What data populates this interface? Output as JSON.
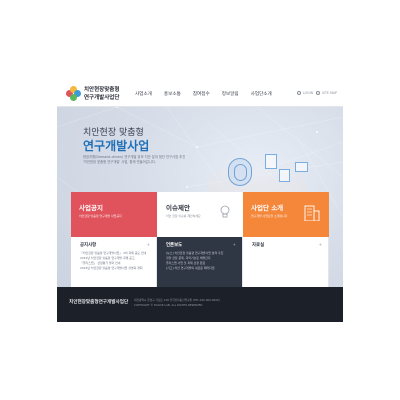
{
  "header": {
    "logo_line1": "치안현장맞춤형",
    "logo_line2": "연구개발사업단",
    "nav": [
      "사업소개",
      "홍보소통",
      "참여접수",
      "정보알림",
      "사업단소개"
    ],
    "links": [
      "LOGIN",
      "SITE MAP"
    ]
  },
  "hero": {
    "subtitle": "치안현장 맞춤형",
    "title": "연구개발사업",
    "desc_line1": "현장지향(Demand-driven) 연구개발 공모 치안 분야 첨단 연구사업 추진",
    "desc_line2": "'치안현장 맞춤형 연구개발' 사업, 함께 만들어갑니다."
  },
  "cards": [
    {
      "title": "사업공지",
      "desc": "치안현장 맞춤형 연구개발 사업공지"
    },
    {
      "title": "이슈제안",
      "desc": "치안 현장 이슈를 제안하세요"
    },
    {
      "title": "사업단 소개",
      "desc": "연구개발 사업단을 소개합니다"
    }
  ],
  "panels": [
    {
      "title": "공지사항",
      "more": "+",
      "items": [
        "「치안현장 맞춤형 연구개발사업」 2차 과제 공모 안내",
        "2019년 치안현장 맞춤형 연구개발 과제 공고",
        "「폴리스랩」 선정평가 결과 안내",
        "2019년 치안현장 맞춤형 연구개발사업 설명회 개최"
      ]
    },
    {
      "title": "언론보도",
      "more": "+",
      "items": [
        "[뉴스] 치안현장 맞춤형 연구개발사업 본격 추진",
        "경찰 현장 문제, 과학기술로 해결한다",
        "폴리스랩 사업 첫 과제 선정 완료",
        "[기고] 치안 연구개발의 새로운 패러다임"
      ]
    },
    {
      "title": "자료실",
      "more": "+",
      "items": []
    }
  ],
  "footer": {
    "logo": "치안현장맞춤형연구개발사업단",
    "address": "대전광역시 유성구 가정로 218 한국전자통신연구원 (TEL 042-000-0000)",
    "copyright": "COPYRIGHT © POLICE LAB. ALL RIGHTS RESERVED."
  },
  "colors": {
    "accent_blue": "#1f6fb8",
    "card_red": "#e0535c",
    "card_orange": "#f5873b",
    "footer_bg": "#1c2029"
  },
  "icons": [
    "logo-emblem",
    "bulb-icon",
    "building-icon",
    "fingerprint-icon"
  ]
}
